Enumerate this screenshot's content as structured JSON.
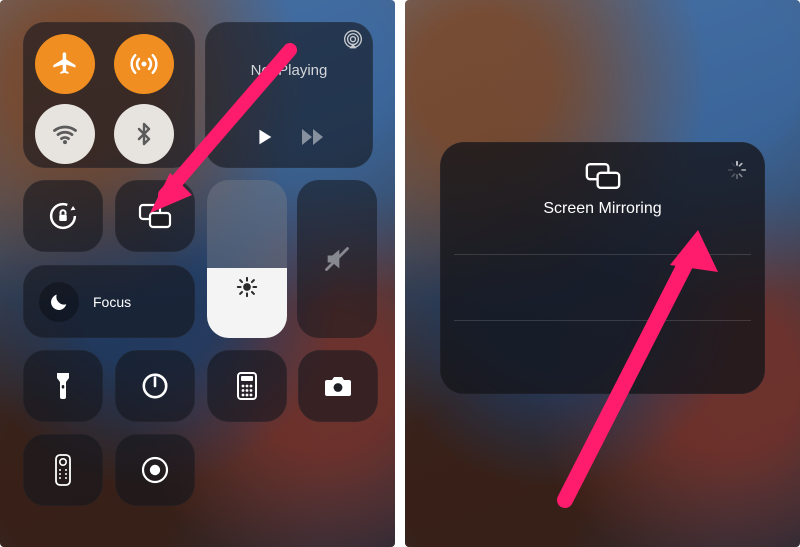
{
  "left": {
    "connectivity": {
      "airplane": "airplane-mode",
      "cellular": "cellular-data",
      "wifi": "wifi",
      "bluetooth": "bluetooth"
    },
    "media": {
      "status": "Not Playing"
    },
    "focus_label": "Focus"
  },
  "right": {
    "mirror_title": "Screen Mirroring"
  },
  "colors": {
    "accent_arrow": "#ff1f6b",
    "toggle_on": "#ec8f28"
  }
}
